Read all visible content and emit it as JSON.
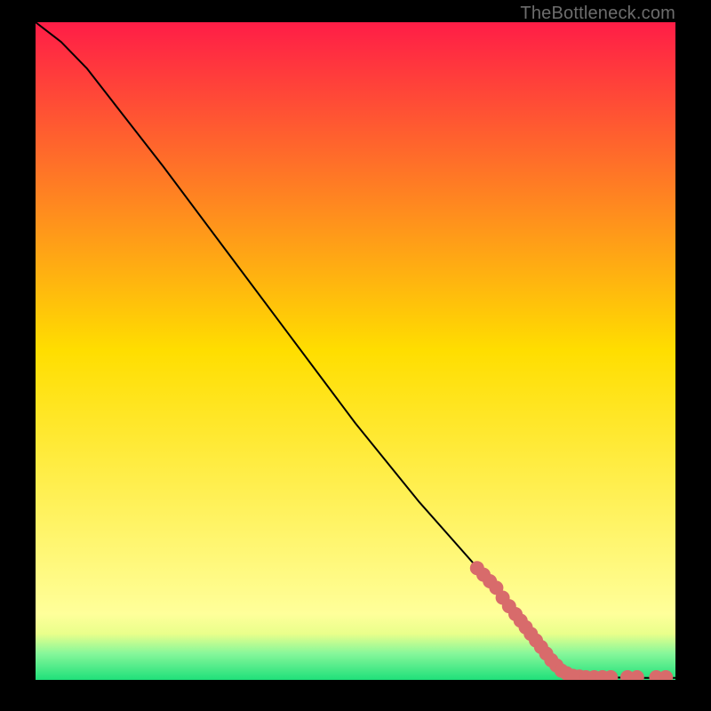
{
  "watermark": "TheBottleneck.com",
  "chart_data": {
    "type": "line",
    "title": "",
    "xlabel": "",
    "ylabel": "",
    "xlim": [
      0,
      100
    ],
    "ylim": [
      0,
      100
    ],
    "grid": false,
    "legend": null,
    "gradient_stops": [
      {
        "offset": 0.0,
        "color": "#ff1d47"
      },
      {
        "offset": 0.5,
        "color": "#ffde00"
      },
      {
        "offset": 0.9,
        "color": "#ffff9a"
      },
      {
        "offset": 0.93,
        "color": "#e9ff8b"
      },
      {
        "offset": 0.96,
        "color": "#86f79a"
      },
      {
        "offset": 1.0,
        "color": "#1fe07a"
      }
    ],
    "series": [
      {
        "name": "curve",
        "type": "line",
        "color": "#000000",
        "width": 2,
        "points": [
          {
            "x": 0,
            "y": 100
          },
          {
            "x": 4,
            "y": 97
          },
          {
            "x": 8,
            "y": 93
          },
          {
            "x": 12,
            "y": 88
          },
          {
            "x": 20,
            "y": 78
          },
          {
            "x": 30,
            "y": 65
          },
          {
            "x": 40,
            "y": 52
          },
          {
            "x": 50,
            "y": 39
          },
          {
            "x": 60,
            "y": 27
          },
          {
            "x": 70,
            "y": 16
          },
          {
            "x": 78,
            "y": 6
          },
          {
            "x": 83,
            "y": 1
          },
          {
            "x": 88,
            "y": 0.4
          },
          {
            "x": 94,
            "y": 0.3
          },
          {
            "x": 100,
            "y": 0.3
          }
        ]
      },
      {
        "name": "markers",
        "type": "scatter",
        "color": "#d86b6b",
        "radius": 8,
        "points": [
          {
            "x": 69,
            "y": 17
          },
          {
            "x": 70,
            "y": 16
          },
          {
            "x": 71,
            "y": 15
          },
          {
            "x": 72,
            "y": 14
          },
          {
            "x": 73,
            "y": 12.5
          },
          {
            "x": 74,
            "y": 11.2
          },
          {
            "x": 75,
            "y": 10
          },
          {
            "x": 75.8,
            "y": 9
          },
          {
            "x": 76.6,
            "y": 8
          },
          {
            "x": 77.4,
            "y": 7
          },
          {
            "x": 78.2,
            "y": 6
          },
          {
            "x": 79,
            "y": 5
          },
          {
            "x": 79.8,
            "y": 4
          },
          {
            "x": 80.6,
            "y": 3
          },
          {
            "x": 81.4,
            "y": 2.2
          },
          {
            "x": 82.2,
            "y": 1.4
          },
          {
            "x": 83,
            "y": 1
          },
          {
            "x": 84,
            "y": 0.6
          },
          {
            "x": 85,
            "y": 0.5
          },
          {
            "x": 86,
            "y": 0.4
          },
          {
            "x": 87.3,
            "y": 0.4
          },
          {
            "x": 88.6,
            "y": 0.4
          },
          {
            "x": 89.9,
            "y": 0.4
          },
          {
            "x": 92.5,
            "y": 0.4
          },
          {
            "x": 94,
            "y": 0.4
          },
          {
            "x": 97,
            "y": 0.4
          },
          {
            "x": 98.5,
            "y": 0.4
          }
        ]
      }
    ]
  }
}
